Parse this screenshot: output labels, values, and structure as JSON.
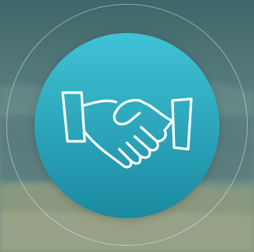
{
  "scene": {
    "icon": "handshake-icon",
    "colors": {
      "badge_top": "#3fc3d6",
      "badge_bottom": "#1a8aa0",
      "icon_stroke": "#ffffff",
      "ring": "#ffffff",
      "sky": "#4f7476",
      "ground": "#7d8f7c"
    }
  }
}
